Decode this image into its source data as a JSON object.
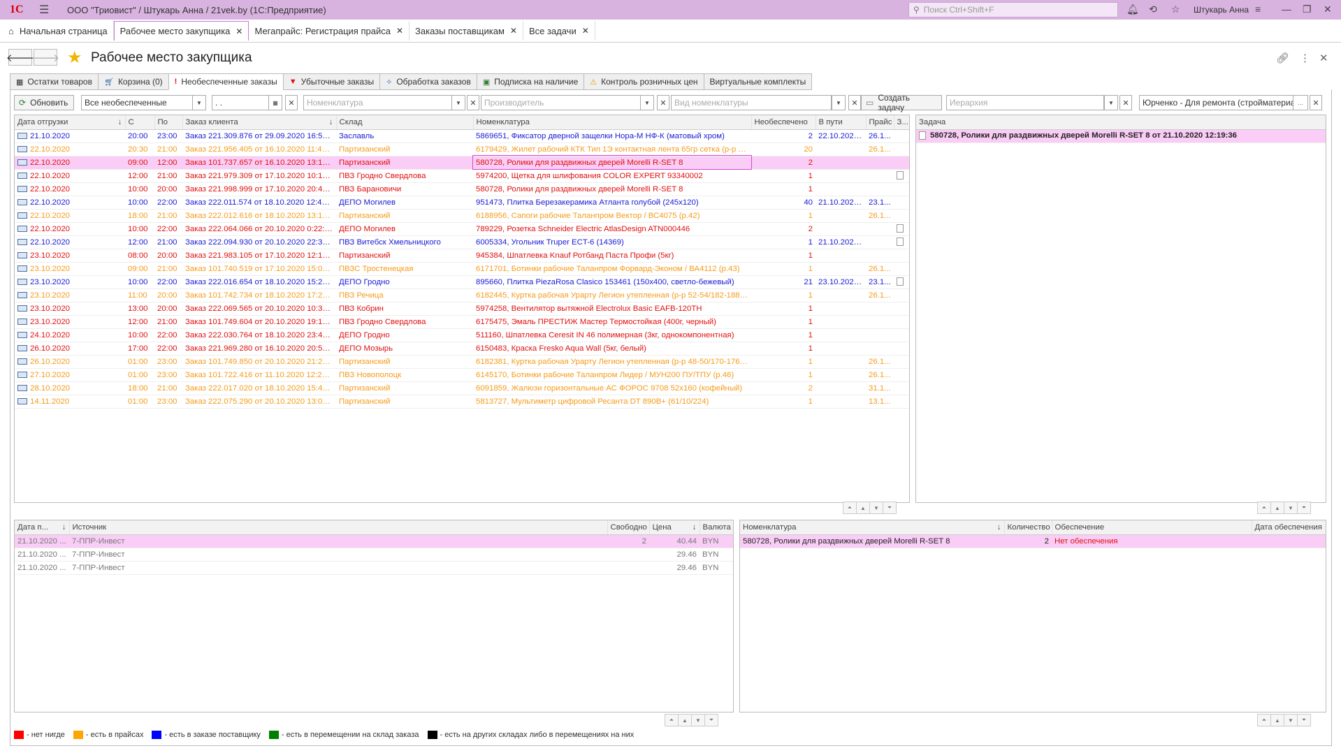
{
  "app": {
    "logo": "1С",
    "title": "ООО \"Триовист\" / Штукарь Анна / 21vek.by  (1С:Предприятие)",
    "search_placeholder": "Поиск Ctrl+Shift+F",
    "user": "Штукарь Анна"
  },
  "open_tabs": [
    {
      "label": "Начальная страница",
      "icon": "home-icon"
    },
    {
      "label": "Рабочее место закупщика",
      "active": true
    },
    {
      "label": "Мегапрайс: Регистрация прайса"
    },
    {
      "label": "Заказы поставщикам"
    },
    {
      "label": "Все задачи"
    }
  ],
  "page_title": "Рабочее место закупщика",
  "sub_tabs": [
    {
      "label": "Остатки товаров",
      "icon": "table-icon"
    },
    {
      "label": "Корзина (0)",
      "icon": "cart-icon"
    },
    {
      "label": "Необеспеченные заказы",
      "icon": "exclamation-icon",
      "active": true
    },
    {
      "label": "Убыточные заказы",
      "icon": "down-arrow-icon"
    },
    {
      "label": "Обработка заказов",
      "icon": "wrench-icon"
    },
    {
      "label": "Подписка на наличие",
      "icon": "subscription-icon"
    },
    {
      "label": "Контроль розничных цен",
      "icon": "warning-icon"
    },
    {
      "label": "Виртуальные комплекты",
      "icon": ""
    }
  ],
  "filters": {
    "refresh_label": "Обновить",
    "status_value": "Все необеспеченные",
    "date_value": ". .",
    "nomenclature_placeholder": "Номенклатура",
    "manufacturer_placeholder": "Производитель",
    "nomenclature_type_placeholder": "Вид номенклатуры",
    "create_task_label": "Создать задачу",
    "hierarchy_placeholder": "Иерархия",
    "responsible_value": "Юрченко - Для ремонта (стройматериалы)"
  },
  "orders": {
    "columns": [
      "Дата отгрузки",
      "С",
      "По",
      "Заказ клиента",
      "Склад",
      "Номенклатура",
      "Необеспечено",
      "В пути",
      "Прайс",
      "З..."
    ],
    "rows": [
      {
        "date": "21.10.2020",
        "from": "20:00",
        "to": "23:00",
        "order": "Заказ 221.309.876 от 29.09.2020 16:59:...",
        "warehouse": "Заславль",
        "item": "5869651, Фиксатор дверной защелки Нора-М НФ-К (матовый хром)",
        "qty": "2",
        "transit": "22.10.2020...",
        "price": "26.1...",
        "doc": false,
        "color": "blue"
      },
      {
        "date": "22.10.2020",
        "from": "20:30",
        "to": "21:00",
        "order": "Заказ 221.956.405 от 16.10.2020 11:46:...",
        "warehouse": "Партизанский",
        "item": "6179429, Жилет рабочий КТК Тип 1Э контактная лента 65гр сетка (р-р 60-...",
        "qty": "20",
        "transit": "",
        "price": "26.1...",
        "doc": false,
        "color": "orange"
      },
      {
        "date": "22.10.2020",
        "from": "09:00",
        "to": "12:00",
        "order": "Заказ 101.737.657 от 16.10.2020 13:13:...",
        "warehouse": "Партизанский",
        "item": "580728, Ролики для раздвижных дверей Morelli R-SET 8",
        "qty": "2",
        "transit": "",
        "price": "",
        "doc": false,
        "color": "red",
        "selected": true
      },
      {
        "date": "22.10.2020",
        "from": "12:00",
        "to": "21:00",
        "order": "Заказ 221.979.309 от 17.10.2020 10:12:...",
        "warehouse": "ПВЗ Гродно Свердлова",
        "item": "5974200, Щетка для шлифования COLOR EXPERT 93340002",
        "qty": "1",
        "transit": "",
        "price": "",
        "doc": true,
        "color": "red"
      },
      {
        "date": "22.10.2020",
        "from": "10:00",
        "to": "20:00",
        "order": "Заказ 221.998.999 от 17.10.2020 20:42:...",
        "warehouse": "ПВЗ Барановичи",
        "item": "580728, Ролики для раздвижных дверей Morelli R-SET 8",
        "qty": "1",
        "transit": "",
        "price": "",
        "doc": false,
        "color": "red"
      },
      {
        "date": "22.10.2020",
        "from": "10:00",
        "to": "22:00",
        "order": "Заказ 222.011.574 от 18.10.2020 12:46:...",
        "warehouse": "ДЕПО Могилев",
        "item": "951473, Плитка Березакерамика Атланта голубой (245х120)",
        "qty": "40",
        "transit": "21.10.2020...",
        "price": "23.1...",
        "doc": false,
        "color": "blue"
      },
      {
        "date": "22.10.2020",
        "from": "18:00",
        "to": "21:00",
        "order": "Заказ 222.012.616 от 18.10.2020 13:19:...",
        "warehouse": "Партизанский",
        "item": "6188956, Сапоги рабочие Таланпром Вектор / ВС4075 (р.42)",
        "qty": "1",
        "transit": "",
        "price": "26.1...",
        "doc": false,
        "color": "orange"
      },
      {
        "date": "22.10.2020",
        "from": "10:00",
        "to": "22:00",
        "order": "Заказ 222.064.066 от 20.10.2020 0:22:3...",
        "warehouse": "ДЕПО Могилев",
        "item": "789229, Розетка Schneider Electric AtlasDesign ATN000446",
        "qty": "2",
        "transit": "",
        "price": "",
        "doc": true,
        "color": "red"
      },
      {
        "date": "22.10.2020",
        "from": "12:00",
        "to": "21:00",
        "order": "Заказ 222.094.930 от 20.10.2020 22:36:...",
        "warehouse": "ПВЗ Витебск Хмельницкого",
        "item": "6005334, Угольник Truper ECT-6 (14369)",
        "qty": "1",
        "transit": "21.10.2020...",
        "price": "",
        "doc": true,
        "color": "blue"
      },
      {
        "date": "23.10.2020",
        "from": "08:00",
        "to": "20:00",
        "order": "Заказ 221.983.105 от 17.10.2020 12:13:...",
        "warehouse": "Партизанский",
        "item": "945384, Шпатлевка Knauf Ротбанд Паста Профи (5кг)",
        "qty": "1",
        "transit": "",
        "price": "",
        "doc": false,
        "color": "red"
      },
      {
        "date": "23.10.2020",
        "from": "09:00",
        "to": "21:00",
        "order": "Заказ 101.740.519 от 17.10.2020 15:02:...",
        "warehouse": "ПВЗС Тростенецкая",
        "item": "6171701, Ботинки рабочие Таланпром Форвард-Эконом / ВА4112 (р.43)",
        "qty": "1",
        "transit": "",
        "price": "26.1...",
        "doc": false,
        "color": "orange"
      },
      {
        "date": "23.10.2020",
        "from": "10:00",
        "to": "22:00",
        "order": "Заказ 222.016.654 от 18.10.2020 15:27:...",
        "warehouse": "ДЕПО Гродно",
        "item": "895660, Плитка PiezaRosa Clasico 153461 (150х400, светло-бежевый)",
        "qty": "21",
        "transit": "23.10.2020...",
        "price": "23.1...",
        "doc": true,
        "color": "blue"
      },
      {
        "date": "23.10.2020",
        "from": "11:00",
        "to": "20:00",
        "order": "Заказ 101.742.734 от 18.10.2020 17:20:...",
        "warehouse": "ПВЗ Речица",
        "item": "6182445, Куртка рабочая Урарту Легион утепленная (р-р 52-54/182-188, те...",
        "qty": "1",
        "transit": "",
        "price": "26.1...",
        "doc": false,
        "color": "orange"
      },
      {
        "date": "23.10.2020",
        "from": "13:00",
        "to": "20:00",
        "order": "Заказ 222.069.565 от 20.10.2020 10:37:...",
        "warehouse": "ПВЗ Кобрин",
        "item": "5974258, Вентилятор вытяжной Electrolux Basic EAFB-120TH",
        "qty": "1",
        "transit": "",
        "price": "",
        "doc": false,
        "color": "red"
      },
      {
        "date": "23.10.2020",
        "from": "12:00",
        "to": "21:00",
        "order": "Заказ 101.749.604 от 20.10.2020 19:18:...",
        "warehouse": "ПВЗ Гродно Свердлова",
        "item": "6175475, Эмаль ПРЕСТИЖ Мастер Термостойкая (400г, черный)",
        "qty": "1",
        "transit": "",
        "price": "",
        "doc": false,
        "color": "red"
      },
      {
        "date": "24.10.2020",
        "from": "10:00",
        "to": "22:00",
        "order": "Заказ 222.030.764 от 18.10.2020 23:44:...",
        "warehouse": "ДЕПО Гродно",
        "item": "511160, Шпатлевка Ceresit IN 46 полимерная (3кг, однокомпонентная)",
        "qty": "1",
        "transit": "",
        "price": "",
        "doc": false,
        "color": "red"
      },
      {
        "date": "26.10.2020",
        "from": "17:00",
        "to": "22:00",
        "order": "Заказ 221.969.280 от 16.10.2020 20:51:...",
        "warehouse": "ДЕПО Мозырь",
        "item": "6150483, Краска Fresko Aqua Wall (5кг, белый)",
        "qty": "1",
        "transit": "",
        "price": "",
        "doc": false,
        "color": "red"
      },
      {
        "date": "26.10.2020",
        "from": "01:00",
        "to": "23:00",
        "order": "Заказ 101.749.850 от 20.10.2020 21:24:...",
        "warehouse": "Партизанский",
        "item": "6182381, Куртка рабочая Урарту Легион утепленная (р-р 48-50/170-176, те...",
        "qty": "1",
        "transit": "",
        "price": "26.1...",
        "doc": false,
        "color": "orange"
      },
      {
        "date": "27.10.2020",
        "from": "01:00",
        "to": "23:00",
        "order": "Заказ 101.722.416 от 11.10.2020 12:23:...",
        "warehouse": "ПВЗ Новополоцк",
        "item": "6145170, Ботинки рабочие Таланпром Лидер / МУН200 ПУ/ТПУ (р.46)",
        "qty": "1",
        "transit": "",
        "price": "26.1...",
        "doc": false,
        "color": "orange"
      },
      {
        "date": "28.10.2020",
        "from": "18:00",
        "to": "21:00",
        "order": "Заказ 222.017.020 от 18.10.2020 15:41:...",
        "warehouse": "Партизанский",
        "item": "6091859, Жалюзи горизонтальные АС ФОРОС 9708 52х160 (кофейный)",
        "qty": "2",
        "transit": "",
        "price": "31.1...",
        "doc": false,
        "color": "orange"
      },
      {
        "date": "14.11.2020",
        "from": "01:00",
        "to": "23:00",
        "order": "Заказ 222.075.290 от 20.10.2020 13:07:...",
        "warehouse": "Партизанский",
        "item": "5813727, Мультиметр цифровой Ресанта DT 890B+ (61/10/224)",
        "qty": "1",
        "transit": "",
        "price": "13.1...",
        "doc": false,
        "color": "orange"
      }
    ]
  },
  "tasks": {
    "column": "Задача",
    "rows": [
      {
        "label": "580728, Ролики для раздвижных дверей Morelli R-SET 8 от 21.10.2020 12:19:36"
      }
    ]
  },
  "sources": {
    "columns": [
      "Дата п...",
      "Источник",
      "Свободно",
      "Цена",
      "Валюта"
    ],
    "rows": [
      {
        "date": "21.10.2020 ...",
        "source": "7-ППР-Инвест",
        "free": "2",
        "price": "40.44",
        "currency": "BYN",
        "selected": true
      },
      {
        "date": "21.10.2020 ...",
        "source": "7-ППР-Инвест",
        "free": "",
        "price": "29.46",
        "currency": "BYN"
      },
      {
        "date": "21.10.2020 ...",
        "source": "7-ППР-Инвест",
        "free": "",
        "price": "29.46",
        "currency": "BYN"
      }
    ]
  },
  "supply": {
    "columns": [
      "Номенклатура",
      "Количество",
      "Обеспечение",
      "Дата обеспечения"
    ],
    "rows": [
      {
        "item": "580728, Ролики для раздвижных дверей Morelli R-SET 8",
        "qty": "2",
        "status": "Нет обеспечения",
        "date": ""
      }
    ]
  },
  "legend": [
    {
      "label": "- нет нигде",
      "color": "#ff0000"
    },
    {
      "label": "- есть в прайсах",
      "color": "#ffa500"
    },
    {
      "label": "- есть в заказе поставщику",
      "color": "#0000ff"
    },
    {
      "label": "- есть в перемещении на склад заказа",
      "color": "#008000"
    },
    {
      "label": "- есть на других складах либо в перемещениях на них",
      "color": "#000000"
    }
  ],
  "colors": {
    "accent": "#d9b3e0",
    "selection": "#f9cdf6",
    "blue": "#1a1ad8",
    "orange": "#f59b1a",
    "red": "#e01010"
  }
}
